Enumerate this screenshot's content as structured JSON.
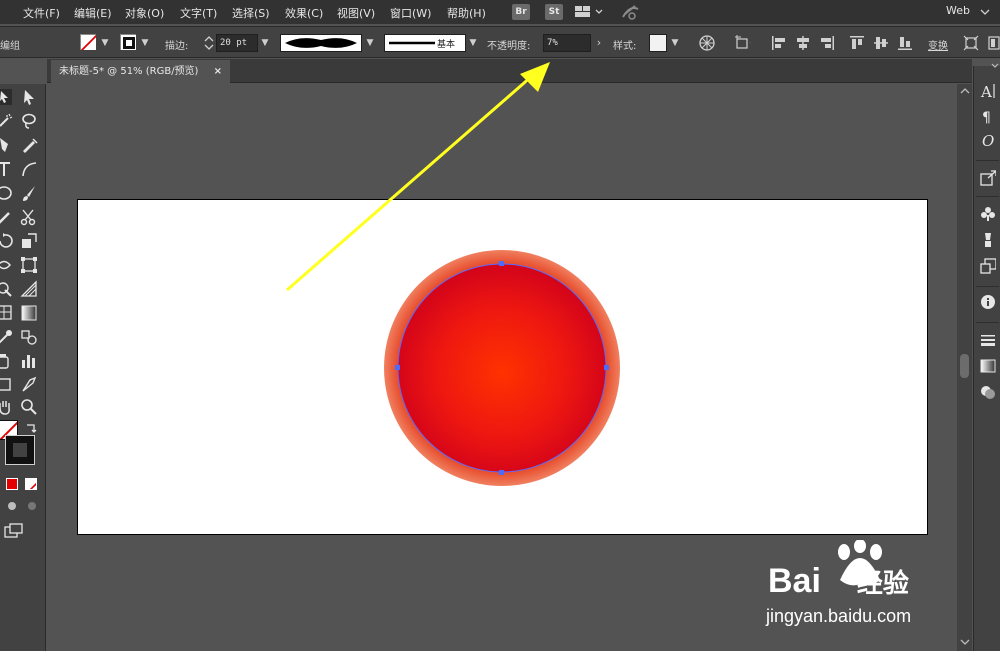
{
  "menubar": {
    "items": [
      "文件(F)",
      "编辑(E)",
      "对象(O)",
      "文字(T)",
      "选择(S)",
      "效果(C)",
      "视图(V)",
      "窗口(W)",
      "帮助(H)"
    ],
    "bridge_label": "Br",
    "stock_label": "St",
    "workspace_label": "Web"
  },
  "controlbar": {
    "group_label": "编组",
    "stroke_label": "描边:",
    "stroke_weight": "20 pt",
    "brush_label": "基本",
    "opacity_label": "不透明度:",
    "opacity_value": "7%",
    "style_label": "样式:",
    "transform_label": "变换"
  },
  "document": {
    "tab_title": "未标题-5* @ 51% (RGB/预览)",
    "close_glyph": "×"
  },
  "watermark": {
    "brand": "Bai",
    "brand_suffix": "经验",
    "url": "jingyan.baidu.com"
  },
  "colors": {
    "menubar_bg": "#323232",
    "panel_bg": "#424242",
    "canvas_bg": "#535353",
    "circle_center": "#ff3000",
    "circle_edge": "#d8001a",
    "circle_glow": "#e85030",
    "selection": "#4b6bff",
    "arrow": "#ffff20"
  }
}
